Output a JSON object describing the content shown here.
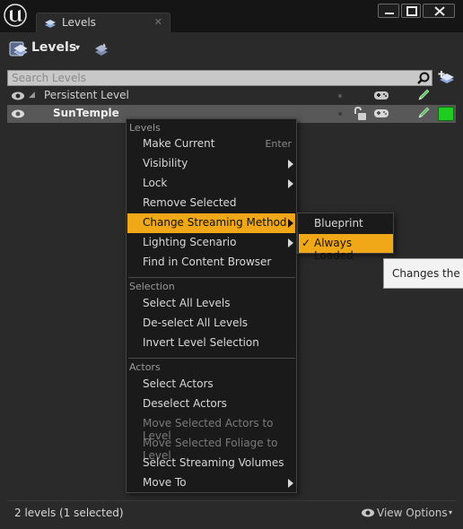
{
  "window": {
    "tab_title": "Levels",
    "tab_close": "✕"
  },
  "toolbar": {
    "levels_label": "Levels",
    "levels_caret": "▾"
  },
  "search": {
    "placeholder": "Search Levels"
  },
  "levels_list": [
    {
      "name": "Persistent Level",
      "selected": false
    },
    {
      "name": "SunTemple",
      "selected": true,
      "color": "#1fcc22"
    }
  ],
  "context_menu": {
    "sections": [
      {
        "header": "Levels",
        "items": [
          {
            "label": "Make Current",
            "shortcut": "Enter"
          },
          {
            "label": "Visibility",
            "submenu": true
          },
          {
            "label": "Lock",
            "submenu": true
          },
          {
            "label": "Remove Selected"
          },
          {
            "label": "Change Streaming Method",
            "submenu": true,
            "highlighted": true
          },
          {
            "label": "Lighting Scenario",
            "submenu": true
          },
          {
            "label": "Find in Content Browser"
          }
        ]
      },
      {
        "header": "Selection",
        "items": [
          {
            "label": "Select All Levels"
          },
          {
            "label": "De-select All Levels"
          },
          {
            "label": "Invert Level Selection"
          }
        ]
      },
      {
        "header": "Actors",
        "items": [
          {
            "label": "Select Actors"
          },
          {
            "label": "Deselect Actors"
          },
          {
            "label": "Move Selected Actors to Level",
            "disabled": true
          },
          {
            "label": "Move Selected Foliage to Level",
            "disabled": true
          },
          {
            "label": "Select Streaming Volumes"
          },
          {
            "label": "Move To",
            "submenu": true
          }
        ]
      }
    ]
  },
  "submenu": {
    "items": [
      {
        "label": "Blueprint",
        "checked": false
      },
      {
        "label": "Always Loaded",
        "checked": true,
        "check_glyph": "✓"
      }
    ]
  },
  "tooltip": {
    "text": "Changes the st"
  },
  "status_bar": {
    "text": "2 levels (1 selected)",
    "view_options_label": "View Options",
    "view_options_caret": "▾"
  },
  "colors": {
    "highlight": "#f0a818",
    "level_color": "#1fcc22",
    "background": "#2a2a2a"
  },
  "icons": [
    "unreal-logo-icon",
    "levels-tab-icon",
    "levels-icon",
    "summary-icon",
    "search-icon",
    "add-level-icon",
    "eye-icon",
    "lock-icon",
    "gamepad-icon",
    "pencil-icon",
    "submenu-arrow-icon"
  ]
}
